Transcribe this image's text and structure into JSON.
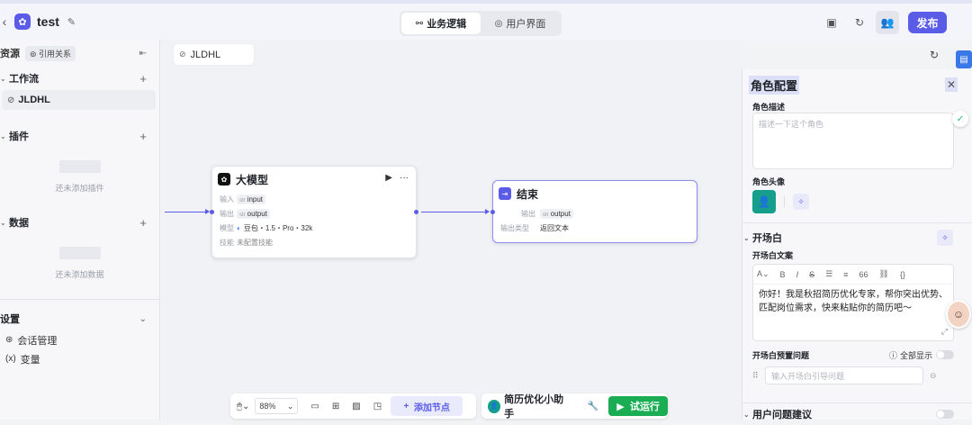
{
  "header": {
    "app_title": "test",
    "tabs": [
      {
        "label": "业务逻辑",
        "icon": "workflow-icon",
        "active": true
      },
      {
        "label": "用户界面",
        "icon": "palette-icon",
        "active": false
      }
    ],
    "publish_label": "发布"
  },
  "sidebar": {
    "title": "资源",
    "ref_button": "引用关系",
    "workflow": {
      "title": "工作流",
      "items": [
        "JLDHL"
      ]
    },
    "plugins": {
      "title": "插件",
      "empty_text": "还未添加插件"
    },
    "data": {
      "title": "数据",
      "empty_text": "还未添加数据"
    },
    "settings": {
      "title": "设置",
      "items": [
        {
          "label": "会话管理",
          "icon": "chat-manage-icon"
        },
        {
          "label": "变量",
          "icon": "variable-icon"
        }
      ]
    }
  },
  "canvas": {
    "breadcrumb": "JLDHL",
    "llm_node": {
      "title": "大模型",
      "rows": [
        {
          "label": "输入",
          "type": "str",
          "value": "input"
        },
        {
          "label": "输出",
          "type": "str",
          "value": "output"
        }
      ],
      "model_label": "模型",
      "model_value": "豆包・1.5・Pro・32k",
      "skill_label": "技能",
      "skill_value": "未配置技能"
    },
    "end_node": {
      "title": "结束",
      "output_label": "输出",
      "output_type": "str",
      "output_value": "output",
      "out_type_label": "输出类型",
      "out_type_value": "返回文本"
    }
  },
  "toolbar": {
    "zoom": "88%",
    "add_node": "添加节点"
  },
  "runbar": {
    "bot_name": "简历优化小助手",
    "run_label": "试运行"
  },
  "panel": {
    "title": "角色配置",
    "desc_label": "角色描述",
    "desc_placeholder": "描述一下这个角色",
    "avatar_label": "角色头像",
    "opening_section": "开场白",
    "opening_text_label": "开场白文案",
    "opening_text": "你好！我是秋招简历优化专家，帮你突出优势、匹配岗位需求，快来粘贴你的简历吧～",
    "preset_label": "开场白预置问题",
    "show_all_label": "全部显示",
    "preset_placeholder": "输入开场白引导问题",
    "suggest_section": "用户问题建议"
  },
  "colors": {
    "accent": "#5a5ce8",
    "run": "#1aad54",
    "avatar": "#159e8c"
  }
}
